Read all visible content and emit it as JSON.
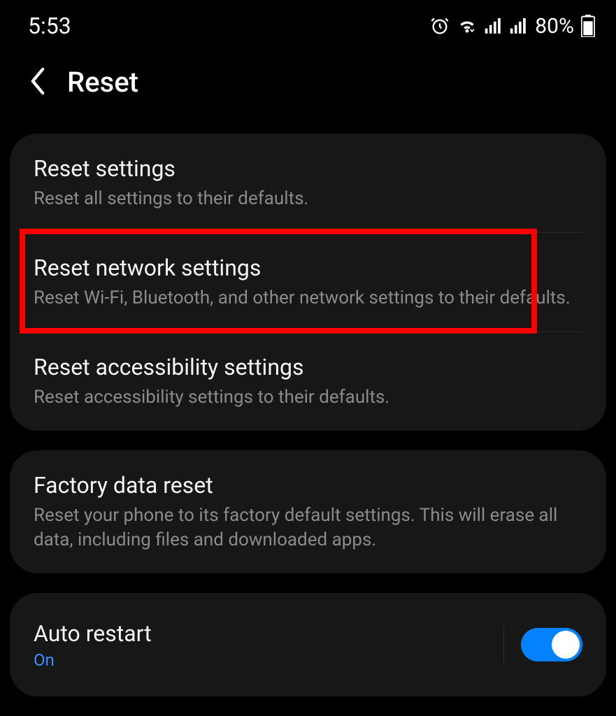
{
  "status_bar": {
    "time": "5:53",
    "battery_pct": "80%"
  },
  "header": {
    "title": "Reset"
  },
  "groups": {
    "g1": {
      "reset_settings": {
        "title": "Reset settings",
        "desc": "Reset all settings to their defaults."
      },
      "reset_network": {
        "title": "Reset network settings",
        "desc": "Reset Wi-Fi, Bluetooth, and other network settings to their defaults."
      },
      "reset_accessibility": {
        "title": "Reset accessibility settings",
        "desc": "Reset accessibility settings to their defaults."
      }
    },
    "g2": {
      "factory_reset": {
        "title": "Factory data reset",
        "desc": "Reset your phone to its factory default settings. This will erase all data, including files and downloaded apps."
      }
    },
    "g3": {
      "auto_restart": {
        "title": "Auto restart",
        "status": "On",
        "enabled": true
      }
    }
  },
  "annotation": {
    "highlight_target": "reset_network"
  }
}
